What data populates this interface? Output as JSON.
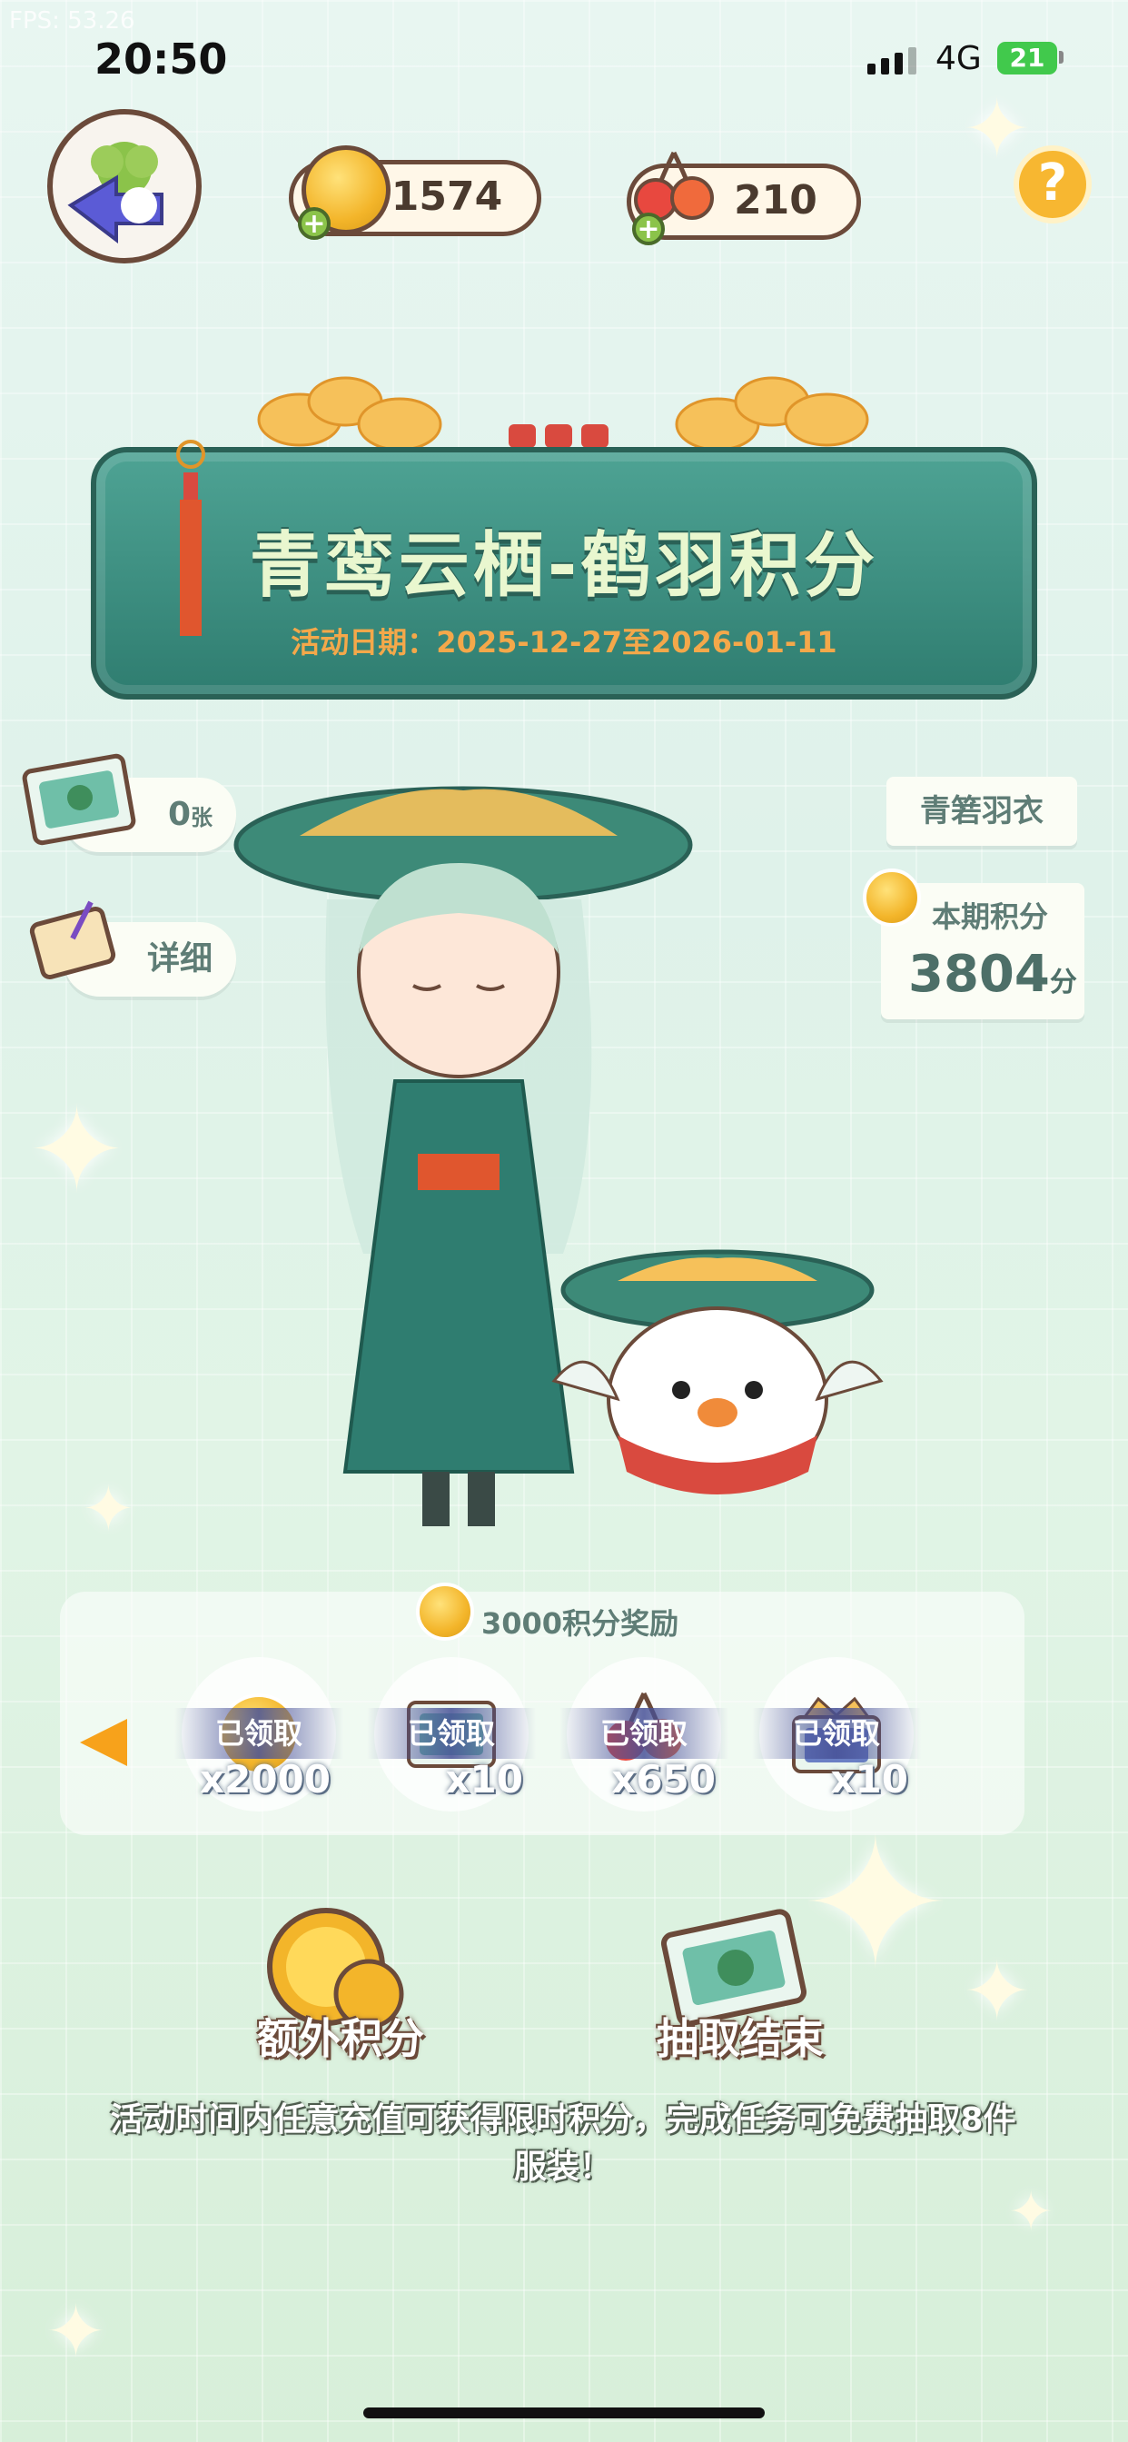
{
  "status_bar": {
    "fps": "FPS: 53.26",
    "time": "20:50",
    "network": "4G",
    "battery": "21"
  },
  "currencies": {
    "coins": "1574",
    "cherries": "210"
  },
  "help_icon": "question-icon",
  "banner": {
    "title": "青鸾云栖-鹤羽积分",
    "date": "活动日期：2025-12-27至2026-01-11"
  },
  "left_buttons": {
    "ticket_count": "0",
    "ticket_unit": "张",
    "detail": "详细"
  },
  "right_panel": {
    "outfit_name": "青箬羽衣",
    "score_label": "本期积分",
    "score_value": "3804",
    "score_unit": "分"
  },
  "rewards": {
    "title": "3000积分奖励",
    "items": [
      {
        "status": "已领取",
        "qty": "x2000",
        "icon": "coin-icon"
      },
      {
        "status": "已领取",
        "qty": "x10",
        "icon": "ticket-icon"
      },
      {
        "status": "已领取",
        "qty": "x650",
        "icon": "cherry-icon"
      },
      {
        "status": "已领取",
        "qty": "x10",
        "icon": "crown-ticket-icon"
      }
    ]
  },
  "actions": {
    "extra_points": "额外积分",
    "draw_end": "抽取结束"
  },
  "description": "活动时间内任意充值可获得限时积分，完成任务可免费抽取8件服装！",
  "colors": {
    "accent_teal": "#2f7d70",
    "gold": "#f3b52a",
    "label_text": "#5f7d76",
    "arrow_orange": "#f7a21b"
  }
}
